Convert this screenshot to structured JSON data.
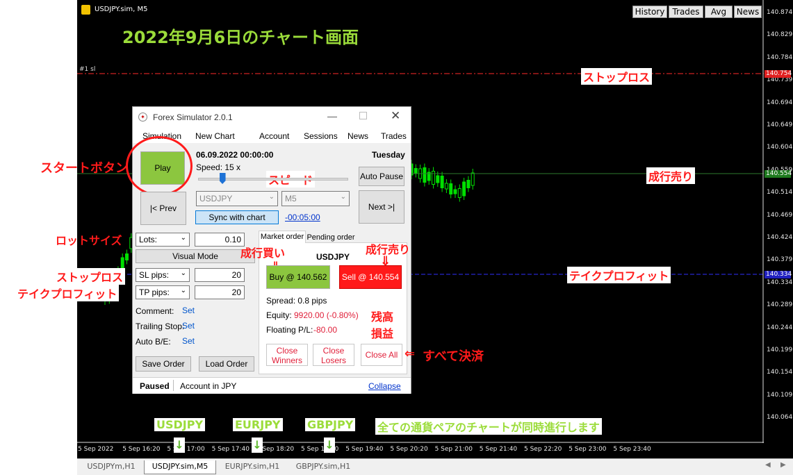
{
  "chart": {
    "window_title": "USDJPY.sim, M5",
    "buttons": [
      "History",
      "Trades",
      "Avg",
      "News"
    ],
    "heading": "2022年9月6日のチャート画面",
    "sl_label": "#1 sl",
    "sl_price": "140.754",
    "tp_price": "140.334",
    "current_price": "140.554",
    "y_labels": [
      "140.874",
      "140.829",
      "140.784",
      "140.739",
      "140.694",
      "140.649",
      "140.604",
      "140.559",
      "140.514",
      "140.469",
      "140.424",
      "140.379",
      "140.334",
      "140.289",
      "140.244",
      "140.199",
      "140.154",
      "140.109",
      "140.064"
    ],
    "x_labels": [
      "5 Sep 2022",
      "5 Sep 16:20",
      "5 Sep 17:00",
      "5 Sep 17:40",
      "5 Sep 18:20",
      "5 Sep 19:00",
      "5 Sep 19:40",
      "5 Sep 20:20",
      "5 Sep 21:00",
      "5 Sep 21:40",
      "5 Sep 22:20",
      "5 Sep 23:00",
      "5 Sep 23:40"
    ],
    "colors": {
      "background": "#000000",
      "candle": "#00e000",
      "sl_line": "#ff2a2a",
      "tp_line": "#2a2aff",
      "annotation": "#ff1a1a",
      "green_note": "#9bdc3a"
    }
  },
  "annotations": {
    "start_button": "スタートボタン",
    "speed": "スピード",
    "lot_size": "ロットサイズ",
    "stop_loss_left": "ストップロス",
    "take_profit_left": "テイクプロフィット",
    "market_buy": "成行買い",
    "market_sell_panel": "成行売り",
    "balance": "残高",
    "pnl": "損益",
    "close_all": "すべて決済",
    "stop_loss_chart": "ストップロス",
    "market_sell_chart": "成行売り",
    "take_profit_chart": "テイクプロフィット",
    "pair1": "USDJPY",
    "pair2": "EURJPY",
    "pair3": "GBPJPY",
    "simultaneous_note": "全ての通貨ペアのチャートが同時進行します"
  },
  "simulator": {
    "title": "Forex Simulator 2.0.1",
    "menu": [
      "Simulation",
      "New Chart",
      "Account",
      "Sessions",
      "News",
      "Trades"
    ],
    "play_label": "Play",
    "datetime": "06.09.2022 00:00:00",
    "weekday": "Tuesday",
    "speed_label": "Speed: 15 x",
    "speed_value_pct": 16,
    "auto_pause_label": "Auto Pause",
    "prev_label": "|< Prev",
    "next_label": "Next >|",
    "symbol_select": "USDJPY",
    "timeframe_select": "M5",
    "sync_label": "Sync with chart",
    "offset_link": "-00:05:00",
    "lots_select": "Lots:",
    "lots_value": "0.10",
    "visual_mode_label": "Visual Mode",
    "sl_select": "SL pips:",
    "sl_value": "20",
    "tp_select": "TP pips:",
    "tp_value": "20",
    "comment_label": "Comment:",
    "trailing_label": "Trailing Stop:",
    "autobe_label": "Auto B/E:",
    "set_label": "Set",
    "save_order_label": "Save Order",
    "load_order_label": "Load Order",
    "tab_market": "Market order",
    "tab_pending": "Pending order",
    "pair": "USDJPY",
    "buy_label": "Buy @ 140.562",
    "sell_label": "Sell @ 140.554",
    "spread": "Spread: 0.8 pips",
    "equity_label": "Equity:",
    "equity_value": "9920.00  (-0.80%)",
    "floating_label": "Floating P/L:",
    "floating_value": "-80.00",
    "close_winners_1": "Close",
    "close_winners_2": "Winners",
    "close_losers_1": "Close",
    "close_losers_2": "Losers",
    "close_all_label": "Close All",
    "status": "Paused",
    "account": "Account in JPY",
    "collapse_label": "Collapse"
  },
  "tabs": [
    "USDJPYm,H1",
    "USDJPY.sim,M5",
    "EURJPY.sim,H1",
    "GBPJPY.sim,H1"
  ]
}
